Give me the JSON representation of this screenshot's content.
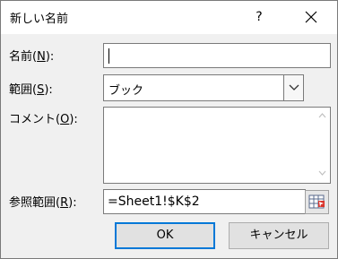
{
  "window": {
    "title": "新しい名前",
    "help": "?"
  },
  "labels": {
    "name_prefix": "名前(",
    "name_key": "N",
    "name_suffix": "):",
    "scope_prefix": "範囲(",
    "scope_key": "S",
    "scope_suffix": "):",
    "comment_prefix": "コメント(",
    "comment_key": "O",
    "comment_suffix": "):",
    "ref_prefix": "参照範囲(",
    "ref_key": "R",
    "ref_suffix": "):"
  },
  "fields": {
    "name_value": "",
    "scope_value": "ブック",
    "comment_value": "",
    "ref_value": "=Sheet1!$K$2"
  },
  "buttons": {
    "ok": "OK",
    "cancel": "キャンセル"
  },
  "colors": {
    "focus_border": "#0078d7",
    "accent_red": "#d9342b"
  }
}
